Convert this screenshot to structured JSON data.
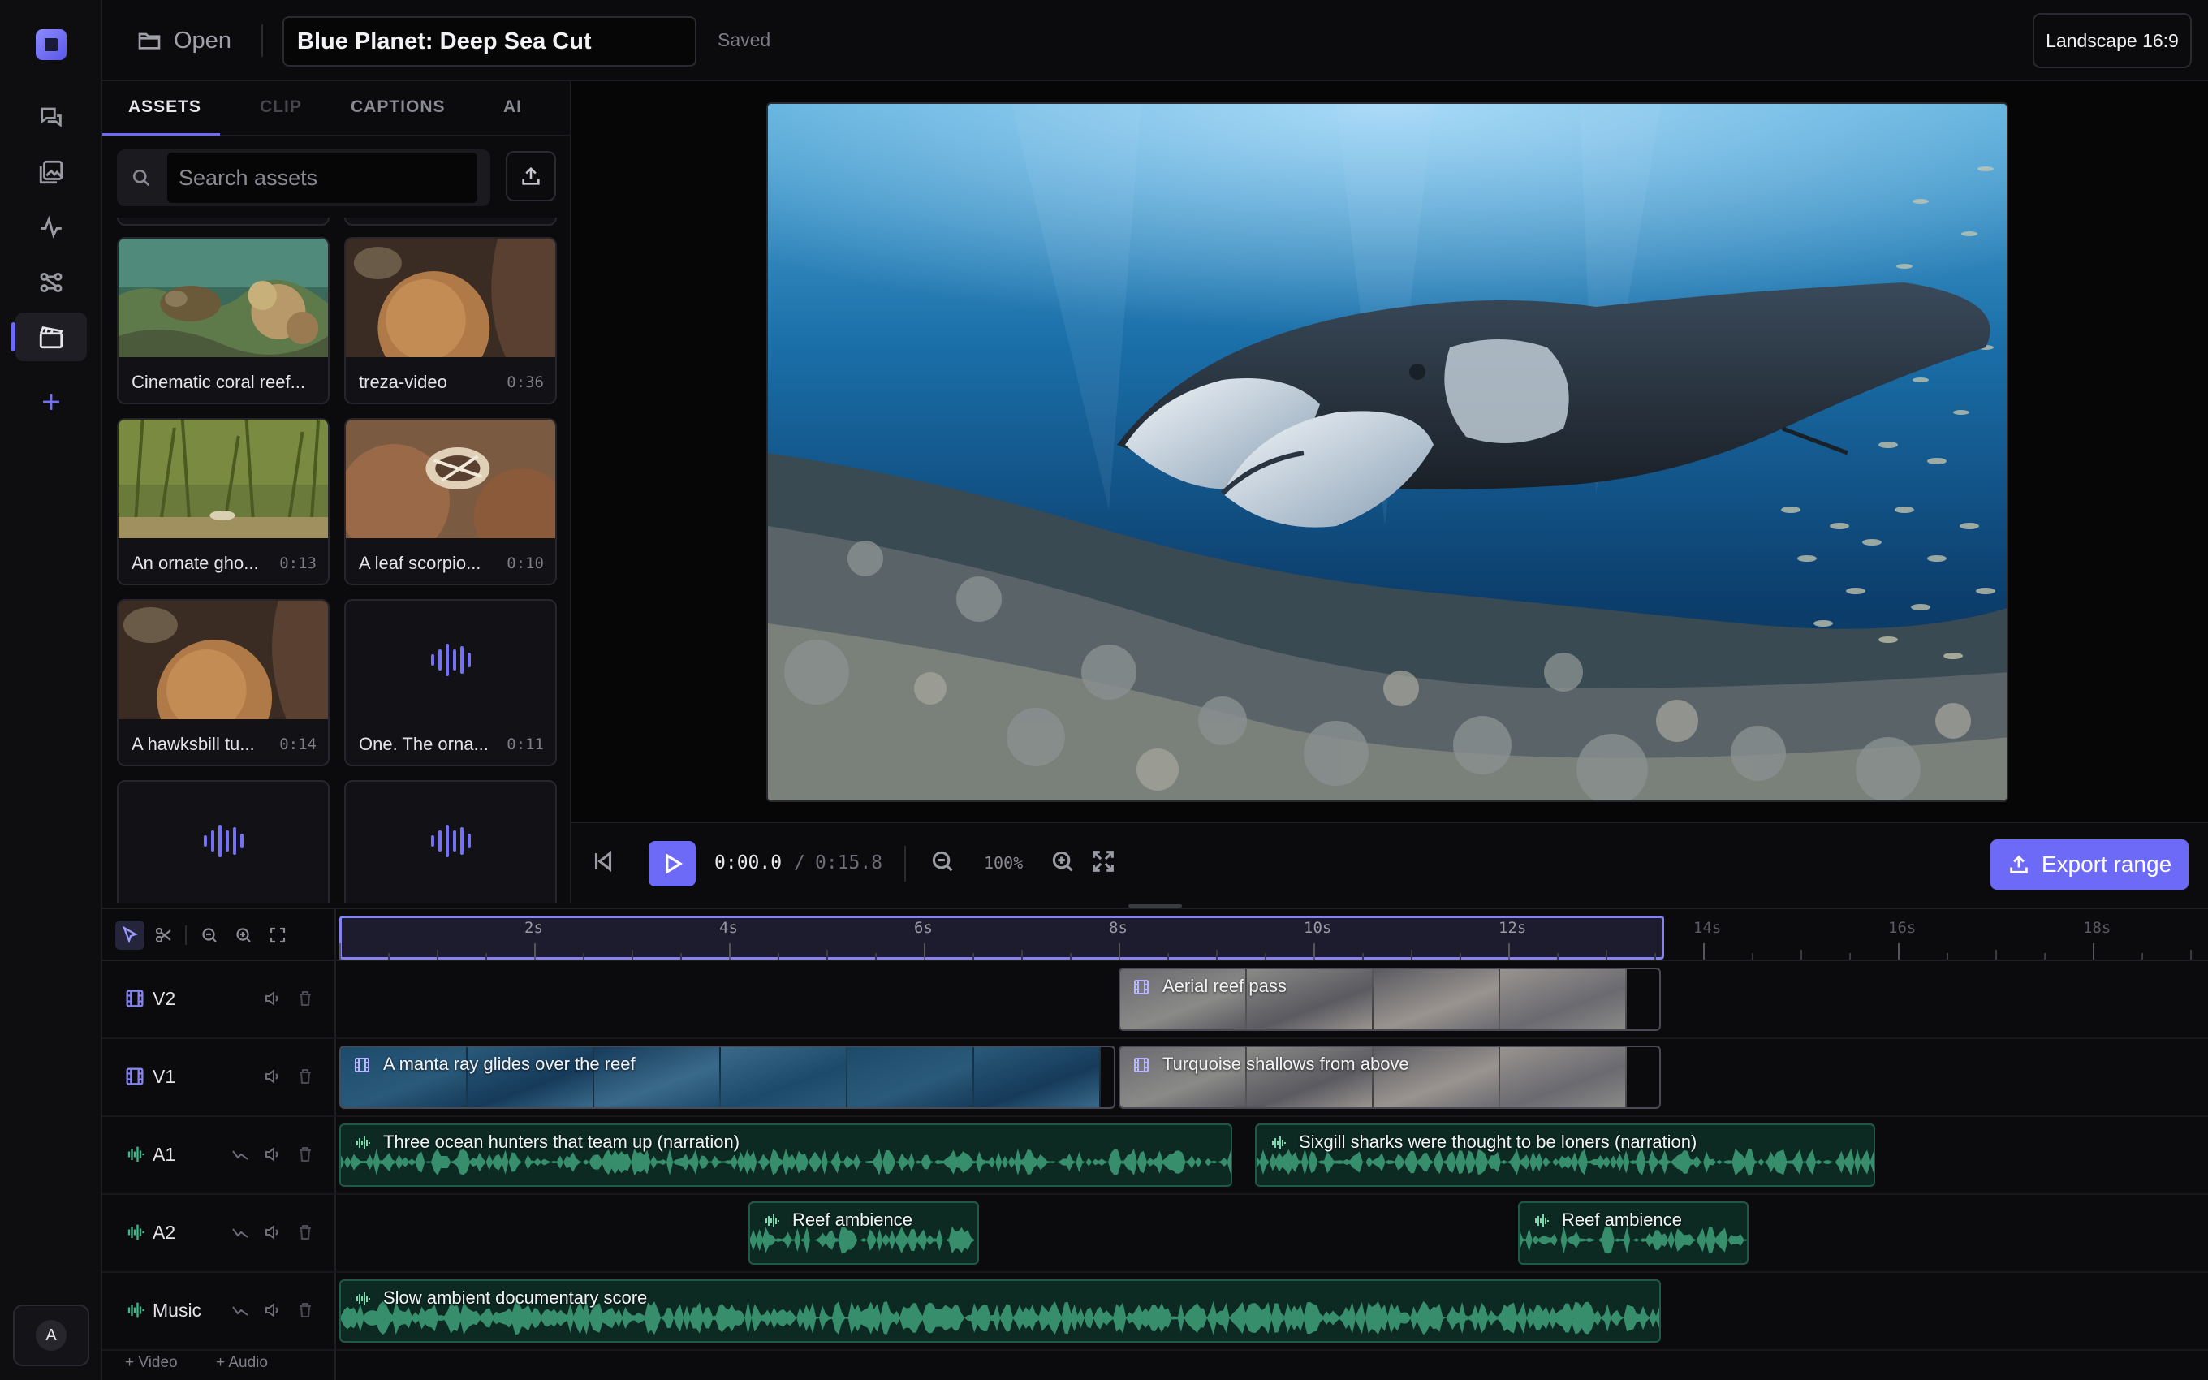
{
  "topbar": {
    "open_label": "Open",
    "project_title": "Blue Planet: Deep Sea Cut",
    "save_status": "Saved",
    "aspect_label": "Landscape 16:9"
  },
  "rail": {
    "items": [
      "chat-icon",
      "gallery-icon",
      "activity-icon",
      "nodes-icon",
      "clapperboard-icon",
      "plus-icon"
    ],
    "active": "clapperboard-icon",
    "avatar_initial": "A"
  },
  "panel": {
    "tabs": [
      {
        "label": "ASSETS",
        "state": "active"
      },
      {
        "label": "CLIP",
        "state": "disabled"
      },
      {
        "label": "CAPTIONS",
        "state": "normal"
      },
      {
        "label": "AI",
        "state": "normal"
      }
    ],
    "search": {
      "placeholder": "Search assets",
      "value": ""
    },
    "assets": [
      {
        "caption": "Cinematic coral reef...",
        "duration": "",
        "kind": "video"
      },
      {
        "caption": "treza-video",
        "duration": "0:36",
        "kind": "video"
      },
      {
        "caption": "An ornate gho...",
        "duration": "0:13",
        "kind": "video"
      },
      {
        "caption": "A leaf scorpio...",
        "duration": "0:10",
        "kind": "video"
      },
      {
        "caption": "A hawksbill tu...",
        "duration": "0:14",
        "kind": "video"
      },
      {
        "caption": "One. The orna...",
        "duration": "0:11",
        "kind": "audio"
      },
      {
        "caption": "",
        "duration": "",
        "kind": "audio"
      },
      {
        "caption": "",
        "duration": "",
        "kind": "audio"
      }
    ]
  },
  "playback": {
    "current_time": "0:00.0",
    "separator": "/",
    "total_time": "0:15.8",
    "zoom": "100%",
    "export_label": "Export range"
  },
  "timeline": {
    "ruler_labels": [
      "2s",
      "4s",
      "6s",
      "8s",
      "10s",
      "12s",
      "14s",
      "16s",
      "18s"
    ],
    "range_seconds": [
      0,
      13.6
    ],
    "tracks": [
      {
        "name": "V2",
        "type": "video",
        "clips": [
          {
            "label": "Aerial reef pass",
            "start": 8.0,
            "end": 13.6
          }
        ]
      },
      {
        "name": "V1",
        "type": "video",
        "clips": [
          {
            "label": "A manta ray glides over the reef",
            "start": 0.0,
            "end": 8.0
          },
          {
            "label": "Turquoise shallows from above",
            "start": 8.0,
            "end": 13.6
          }
        ]
      },
      {
        "name": "A1",
        "type": "audio",
        "clips": [
          {
            "label": "Three ocean hunters that team up (narration)",
            "start": 0.0,
            "end": 9.2
          },
          {
            "label": "Sixgill sharks were thought to be loners (narration)",
            "start": 9.4,
            "end": 15.8
          }
        ]
      },
      {
        "name": "A2",
        "type": "audio",
        "clips": [
          {
            "label": "Reef ambience",
            "start": 4.2,
            "end": 6.6
          },
          {
            "label": "Reef ambience",
            "start": 12.1,
            "end": 14.5
          }
        ]
      },
      {
        "name": "Music",
        "type": "audio",
        "clips": [
          {
            "label": "Slow ambient documentary score",
            "start": 0.0,
            "end": 13.6
          }
        ]
      }
    ],
    "add_video_label": "+ Video",
    "add_audio_label": "+ Audio"
  },
  "colors": {
    "accent": "#6d6af7",
    "audio_clip": "#0c2a22",
    "waveform": "#3fa07a",
    "video_track_icon": "#8583f0",
    "audio_track_icon": "#3fb88a"
  }
}
